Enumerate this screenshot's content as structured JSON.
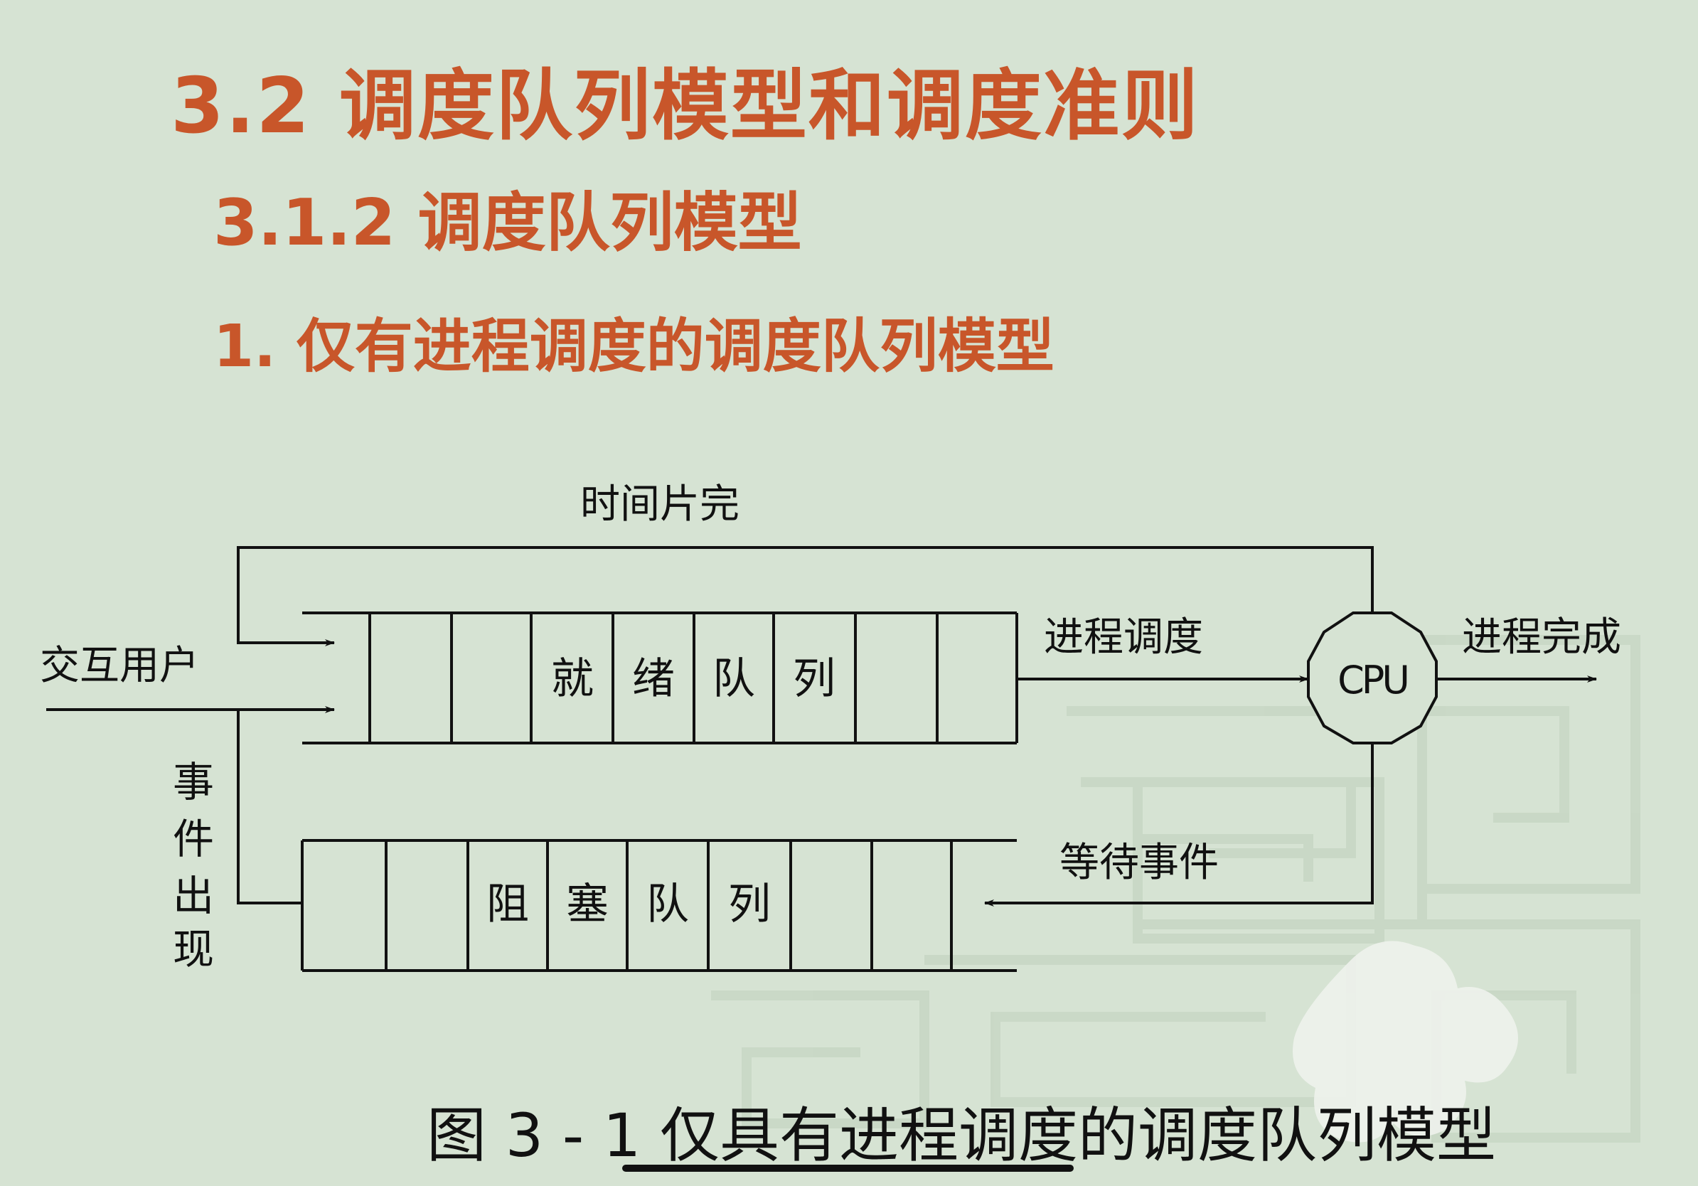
{
  "slide": {
    "title": "3.2 调度队列模型和调度准则",
    "subtitle": "3.1.2 调度队列模型",
    "point": "1. 仅有进程调度的调度队列模型"
  },
  "diagram": {
    "labels": {
      "time_slice_done": "时间片完",
      "interactive_user": "交互用户",
      "process_dispatch": "进程调度",
      "cpu": "CPU",
      "process_complete": "进程完成",
      "wait_event": "等待事件",
      "event_occurs": [
        "事",
        "件",
        "出",
        "现"
      ]
    },
    "ready_queue": {
      "label_chars": [
        "就",
        "绪",
        "队",
        "列"
      ]
    },
    "blocked_queue": {
      "label_chars": [
        "阻",
        "塞",
        "队",
        "列"
      ]
    }
  },
  "caption": "图 3 - 1 仅具有进程调度的调度队列模型",
  "colors": {
    "background": "#d6e3d3",
    "heading": "#c8562a",
    "ink": "#111111"
  }
}
